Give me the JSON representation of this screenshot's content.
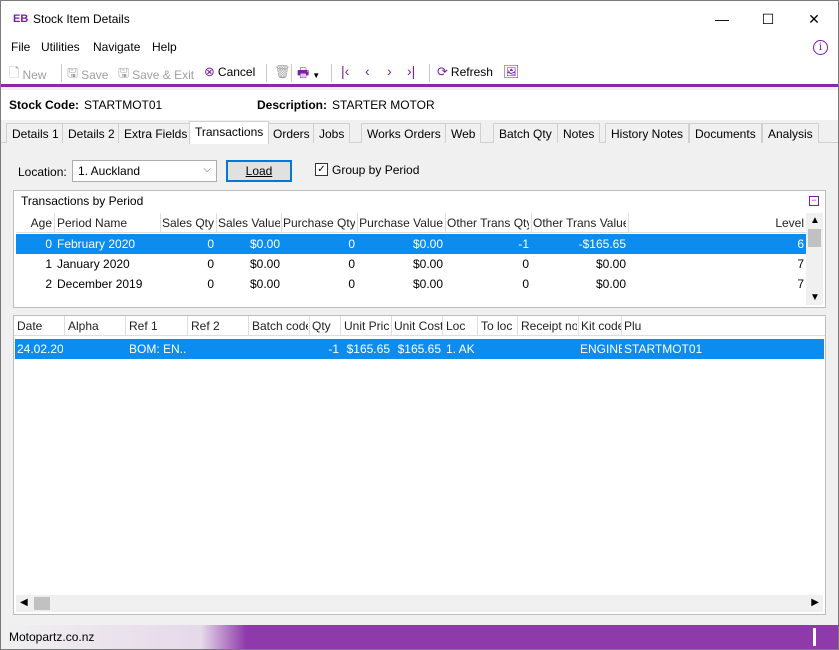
{
  "window": {
    "logo": "EB",
    "title": "Stock Item Details",
    "minimize": "—",
    "maximize": "☐",
    "close": "✕"
  },
  "menu": {
    "file": "File",
    "utilities": "Utilities",
    "navigate": "Navigate",
    "help": "Help"
  },
  "toolbar": {
    "new_label": "New",
    "save_label": "Save",
    "save_exit_label": "Save & Exit",
    "cancel_label": "Cancel",
    "refresh_label": "Refresh"
  },
  "header": {
    "stock_code_label": "Stock Code:",
    "stock_code_value": "STARTMOT01",
    "description_label": "Description:",
    "description_value": "STARTER MOTOR"
  },
  "tabs": [
    "Details 1",
    "Details 2",
    "Extra Fields",
    "Transactions",
    "Orders",
    "Jobs",
    "Works Orders",
    "Web",
    "Batch Qty",
    "Notes",
    "History Notes",
    "Documents",
    "Analysis"
  ],
  "active_tab": "Transactions",
  "filter": {
    "location_label": "Location:",
    "location_value": "1. Auckland",
    "load_label": "Load",
    "group_by_period_label": "Group by Period",
    "group_by_period_checked": true
  },
  "period_panel": {
    "title": "Transactions by Period",
    "columns": [
      "Age",
      "Period Name",
      "Sales Qty",
      "Sales Value",
      "Purchase Qty",
      "Purchase Value",
      "Other Trans Qty",
      "Other Trans Value",
      "Level"
    ],
    "rows": [
      [
        "0",
        "February 2020",
        "0",
        "$0.00",
        "0",
        "$0.00",
        "-1",
        "-$165.65",
        "6"
      ],
      [
        "1",
        "January 2020",
        "0",
        "$0.00",
        "0",
        "$0.00",
        "0",
        "$0.00",
        "7"
      ],
      [
        "2",
        "December 2019",
        "0",
        "$0.00",
        "0",
        "$0.00",
        "0",
        "$0.00",
        "7"
      ]
    ],
    "selected_row": 0
  },
  "detail_grid": {
    "columns": [
      "Date",
      "Alpha",
      "Ref 1",
      "Ref 2",
      "Batch code",
      "Qty",
      "Unit Price",
      "Unit Cost",
      "Loc",
      "To loc",
      "Receipt no",
      "Kit code",
      "Plu"
    ],
    "rows": [
      [
        "24.02.20",
        "",
        "BOM: EN...",
        "",
        "",
        "-1",
        "$165.65",
        "$165.65",
        "1. AK",
        "",
        "",
        "ENGINE",
        "STARTMOT01"
      ]
    ]
  },
  "status": {
    "text": "Motopartz.co.nz"
  }
}
